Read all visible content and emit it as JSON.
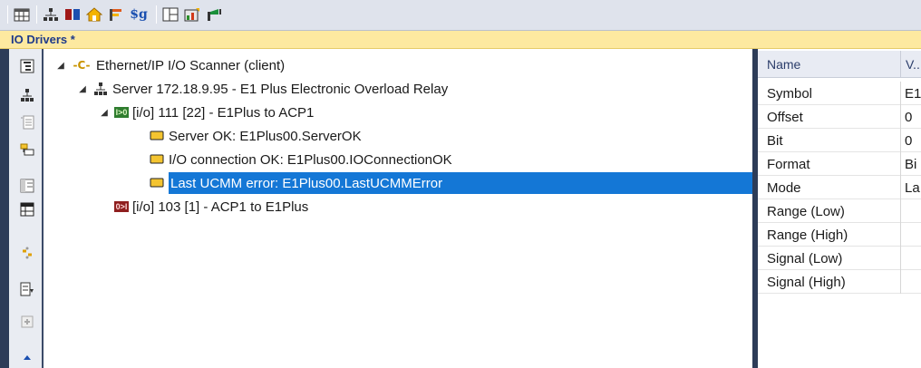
{
  "panel": {
    "title": "IO Drivers *"
  },
  "toolbar": {
    "icons": [
      "table-icon",
      "network-icon",
      "io-icon",
      "home-icon",
      "flag-icon",
      "variable-icon",
      "layout-icon",
      "chart-icon",
      "signal-icon"
    ],
    "variable_label": "$g"
  },
  "sidebar": {
    "icons": [
      "tree-view-icon",
      "network-icon",
      "list-icon",
      "connector-icon",
      "panel-icon",
      "grid-icon",
      "link-icon",
      "import-icon",
      "add-icon",
      "arrow-up-icon"
    ]
  },
  "tree": {
    "scanner": {
      "label": "Ethernet/IP I/O Scanner (client)",
      "expander": "◢",
      "icon_glyph": "-C-"
    },
    "server": {
      "label": "Server 172.18.9.95 - E1 Plus Electronic Overload Relay",
      "expander": "◢"
    },
    "io_111": {
      "label": "[i/o] 111 [22] - E1Plus to ACP1",
      "expander": "◢",
      "icon_glyph": "I>0"
    },
    "items": [
      {
        "label": "Server OK: E1Plus00.ServerOK",
        "selected": false
      },
      {
        "label": "I/O connection OK: E1Plus00.IOConnectionOK",
        "selected": false
      },
      {
        "label": "Last UCMM error: E1Plus00.LastUCMMError",
        "selected": true
      }
    ],
    "io_103": {
      "label": "[i/o] 103 [1] - ACP1 to E1Plus",
      "icon_glyph": "0>I"
    }
  },
  "properties": {
    "headers": [
      "Name",
      "V..."
    ],
    "rows": [
      {
        "name": "Symbol",
        "value": "E1"
      },
      {
        "name": "Offset",
        "value": "0"
      },
      {
        "name": "Bit",
        "value": "0"
      },
      {
        "name": "Format",
        "value": "Bi"
      },
      {
        "name": "Mode",
        "value": "La"
      },
      {
        "name": "Range (Low)",
        "value": ""
      },
      {
        "name": "Range (High)",
        "value": ""
      },
      {
        "name": "Signal (Low)",
        "value": ""
      },
      {
        "name": "Signal (High)",
        "value": ""
      }
    ]
  },
  "colors": {
    "header_bg": "#fde9a0",
    "title_text": "#1e3a8a",
    "selection": "#1477d6",
    "dark_frame": "#2d3c58"
  }
}
